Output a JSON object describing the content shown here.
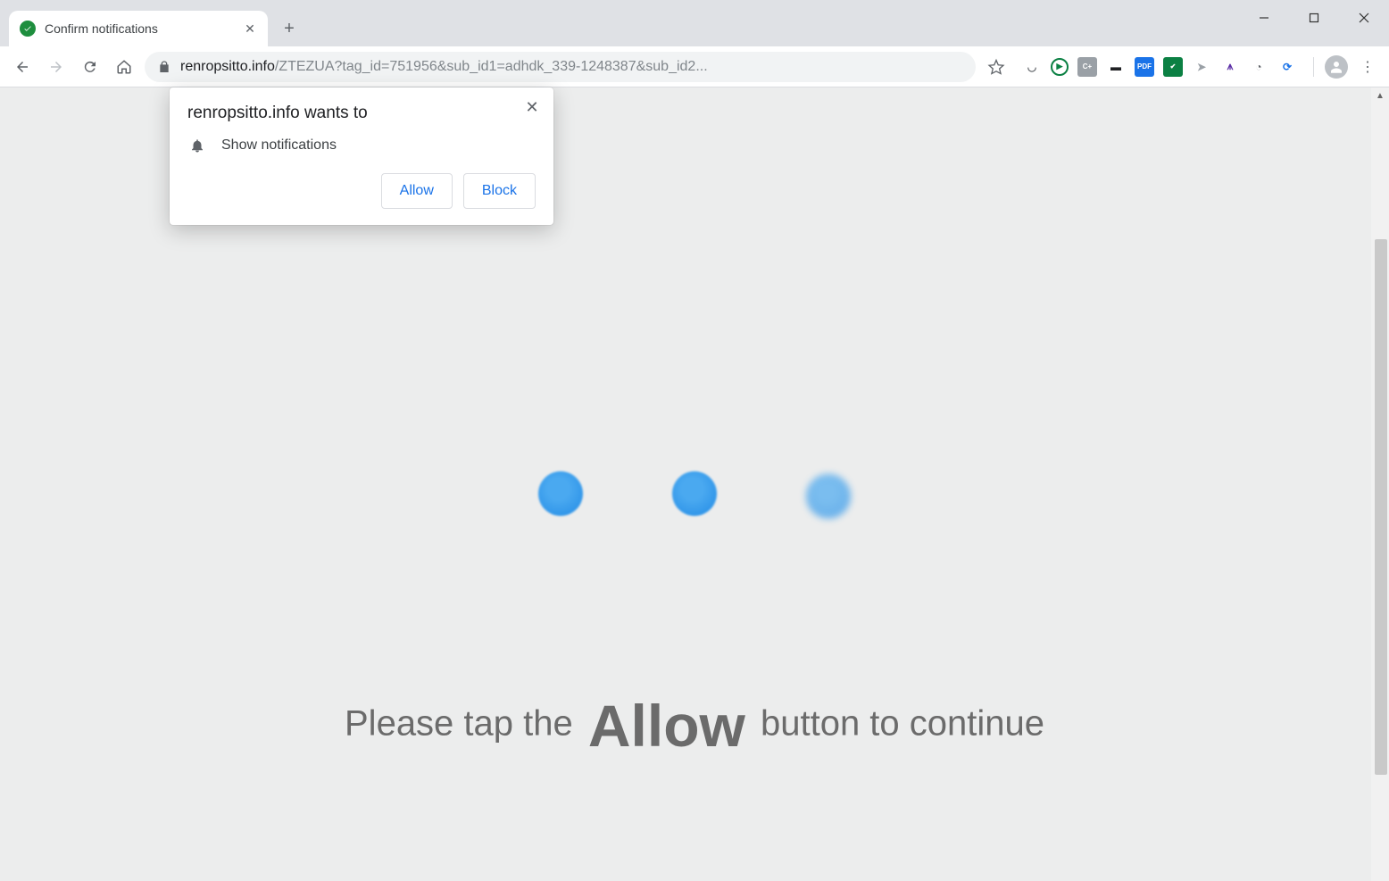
{
  "window": {
    "tab_title": "Confirm notifications"
  },
  "toolbar": {
    "url_host": "renropsitto.info",
    "url_rest": "/ZTEZUA?tag_id=751956&sub_id1=adhdk_339-1248387&sub_id2...",
    "extensions": [
      {
        "name": "arc-icon",
        "glyph": "◡",
        "color": "#5f6368",
        "bg": ""
      },
      {
        "name": "play-icon",
        "glyph": "▶",
        "color": "#0b8043",
        "bg": "",
        "ring": true
      },
      {
        "name": "c-plus-icon",
        "glyph": "C+",
        "color": "#fff",
        "bg": "#9aa0a6"
      },
      {
        "name": "screen-icon",
        "glyph": "▬",
        "color": "#202124",
        "bg": ""
      },
      {
        "name": "pdf-icon",
        "glyph": "PDF",
        "color": "#fff",
        "bg": "#1a73e8"
      },
      {
        "name": "shield-icon",
        "glyph": "✔",
        "color": "#fff",
        "bg": "#0b8043"
      },
      {
        "name": "send-icon",
        "glyph": "➤",
        "color": "#9aa0a6",
        "bg": ""
      },
      {
        "name": "graph-icon",
        "glyph": "⩚",
        "color": "#5b2ea6",
        "bg": ""
      },
      {
        "name": "gauge-icon",
        "glyph": "◔",
        "color": "#5f6368",
        "bg": ""
      },
      {
        "name": "refresh-icon",
        "glyph": "⟳",
        "color": "#1a73e8",
        "bg": ""
      }
    ]
  },
  "permission": {
    "title": "renropsitto.info wants to",
    "line": "Show notifications",
    "allow": "Allow",
    "block": "Block"
  },
  "page": {
    "headline_pre": "Please tap the ",
    "headline_strong": "Allow",
    "headline_post": " button to continue"
  }
}
